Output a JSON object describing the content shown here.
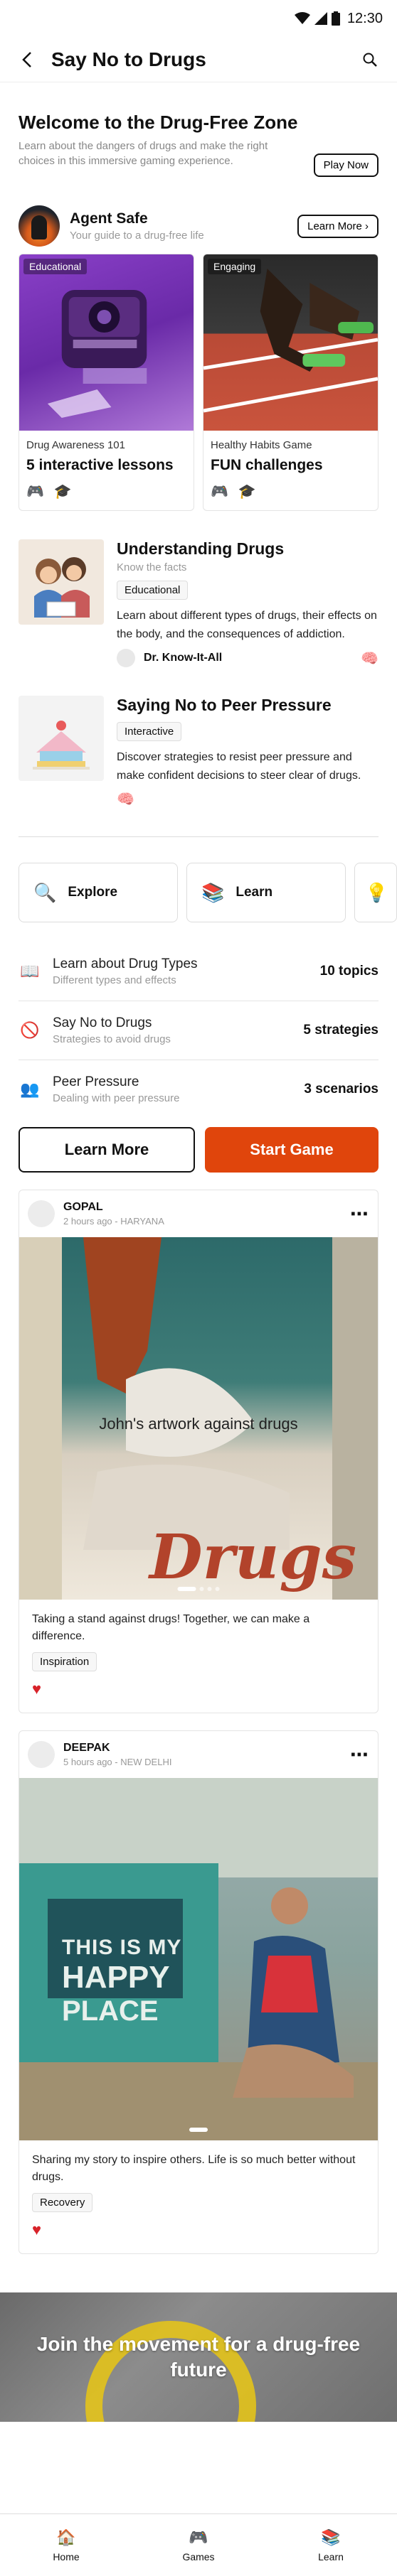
{
  "status_bar": {
    "time": "12:30"
  },
  "app_bar": {
    "title": "Say No to Drugs"
  },
  "hero": {
    "title": "Welcome to the Drug-Free Zone",
    "subtitle": "Learn about the dangers of drugs and make the right choices in this immersive gaming experience.",
    "button": "Play Now"
  },
  "agent": {
    "name": "Agent Safe",
    "subtitle": "Your guide to a drug-free life",
    "button": "Learn More"
  },
  "cards": [
    {
      "tag": "Educational",
      "sub": "Drug Awareness 101",
      "main": "5 interactive lessons",
      "icons": [
        "gamepad-icon",
        "graduation-cap-icon"
      ]
    },
    {
      "tag": "Engaging",
      "sub": "Healthy Habits Game",
      "main": "FUN challenges",
      "icons": [
        "gamepad-icon",
        "graduation-cap-icon"
      ]
    }
  ],
  "features": [
    {
      "title": "Understanding Drugs",
      "subtitle": "Know the facts",
      "chip": "Educational",
      "desc": "Learn about different types of drugs, their effects on the body, and the consequences of addiction.",
      "author": "Dr. Know-It-All"
    },
    {
      "title": "Saying No to Peer Pressure",
      "chip": "Interactive",
      "desc": "Discover strategies to resist peer pressure and make confident decisions to steer clear of drugs."
    }
  ],
  "scroller": [
    {
      "label": "Explore",
      "icon": "magnifier-icon"
    },
    {
      "label": "Learn",
      "icon": "books-icon"
    }
  ],
  "list": [
    {
      "title": "Learn about Drug Types",
      "subtitle": "Different types and effects",
      "value": "10 topics",
      "icon": "book-icon"
    },
    {
      "title": "Say No to Drugs",
      "subtitle": "Strategies to avoid drugs",
      "value": "5 strategies",
      "icon": "prohibited-icon"
    },
    {
      "title": "Peer Pressure",
      "subtitle": "Dealing with peer pressure",
      "value": "3 scenarios",
      "icon": "people-icon"
    }
  ],
  "cta": {
    "learn_more": "Learn More",
    "start_game": "Start Game"
  },
  "posts": [
    {
      "author": "GOPAL",
      "meta": "2 hours ago - HARYANA",
      "image_caption": "John's artwork against drugs",
      "image_text": "Drugs",
      "text": "Taking a stand against drugs! Together, we can make a difference.",
      "chip": "Inspiration"
    },
    {
      "author": "DEEPAK",
      "meta": "5 hours ago - NEW DELHI",
      "image_sign_1": "THIS IS MY",
      "image_sign_2": "HAPPY",
      "image_sign_3": "PLACE",
      "text": "Sharing my story to inspire others. Life is so much better without drugs.",
      "chip": "Recovery"
    }
  ],
  "banner": {
    "text": "Join the movement for a drug-free future"
  },
  "bottom_nav": [
    {
      "label": "Home",
      "icon": "home-icon"
    },
    {
      "label": "Games",
      "icon": "gamepad-icon"
    },
    {
      "label": "Learn",
      "icon": "books-icon"
    }
  ]
}
